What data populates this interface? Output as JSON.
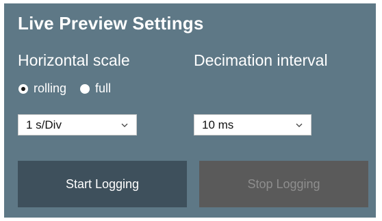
{
  "panel": {
    "title": "Live Preview Settings"
  },
  "horizontal_scale": {
    "label": "Horizontal scale",
    "radios": [
      {
        "label": "rolling",
        "checked": true
      },
      {
        "label": "full",
        "checked": false
      }
    ],
    "select_value": "1 s/Div",
    "select_icon": "chevron-down-icon"
  },
  "decimation": {
    "label": "Decimation interval",
    "select_value": "10 ms",
    "select_icon": "chevron-down-icon"
  },
  "buttons": {
    "start_label": "Start Logging",
    "stop_label": "Stop Logging",
    "stop_enabled": false
  },
  "colors": {
    "panel_bg": "#5e7886",
    "start_button_bg": "#3e505c",
    "stop_button_bg": "#5a5a5a",
    "disabled_text": "#8e8e8e"
  }
}
